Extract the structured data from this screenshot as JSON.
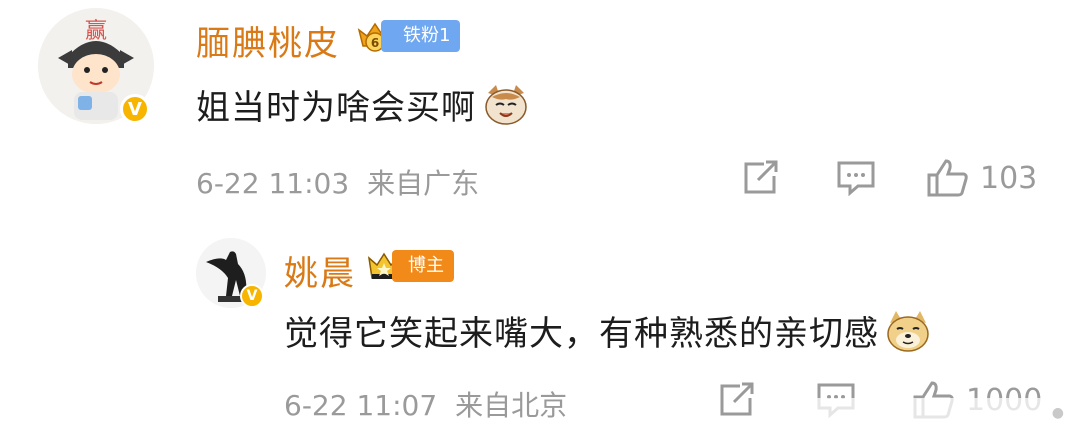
{
  "comments": [
    {
      "username": "腼腆桃皮",
      "fan_badge": "铁粉1",
      "fan_level": "6",
      "content": "姐当时为啥会买啊",
      "emoji": "cat-emoji",
      "time": "6-22 11:03",
      "location": "来自广东",
      "likes": "103",
      "verified_mark": "V",
      "avatar_char": "赢"
    },
    {
      "username": "姚晨",
      "owner_badge": "博主",
      "content": "觉得它笑起来嘴大，有种熟悉的亲切感",
      "emoji": "doge-emoji",
      "time": "6-22 11:07",
      "location": "来自北京",
      "likes": "1000",
      "verified_mark": "V"
    }
  ],
  "colors": {
    "username": "#d97a17",
    "meta": "#9a9a9a",
    "fan_badge": "#6fa7f0",
    "owner_badge": "#f28a1a",
    "verified": "#f7b500"
  }
}
